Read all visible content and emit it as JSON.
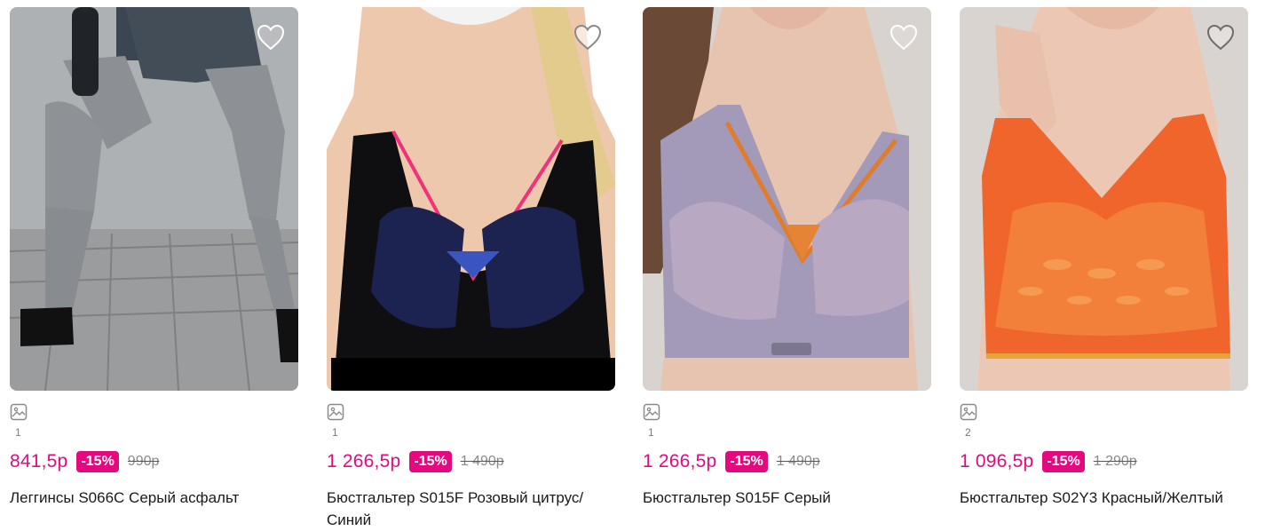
{
  "products": [
    {
      "title": "Леггинсы S066C Серый асфальт",
      "price": "841,5р",
      "discount": "-15%",
      "old_price": "990р",
      "photo_count": "1",
      "bg": "#b9bbbd"
    },
    {
      "title": "Бюстгальтер S015F Розовый цитрус/Синий",
      "price": "1 266,5р",
      "discount": "-15%",
      "old_price": "1 490р",
      "photo_count": "1",
      "bg": "#ffffff"
    },
    {
      "title": "Бюстгальтер S015F Серый",
      "price": "1 266,5р",
      "discount": "-15%",
      "old_price": "1 490р",
      "photo_count": "1",
      "bg": "#d8d3cf"
    },
    {
      "title": "Бюстгальтер S02Y3 Красный/Желтый",
      "price": "1 096,5р",
      "discount": "-15%",
      "old_price": "1 290р",
      "photo_count": "2",
      "bg": "#d9d4d0"
    }
  ],
  "colors": {
    "accent": "#e5097f",
    "old_price": "#8a8a8a",
    "text": "#1a1a1a"
  },
  "icons": {
    "favorite": "heart-outline-icon",
    "gallery": "image-gallery-icon"
  }
}
